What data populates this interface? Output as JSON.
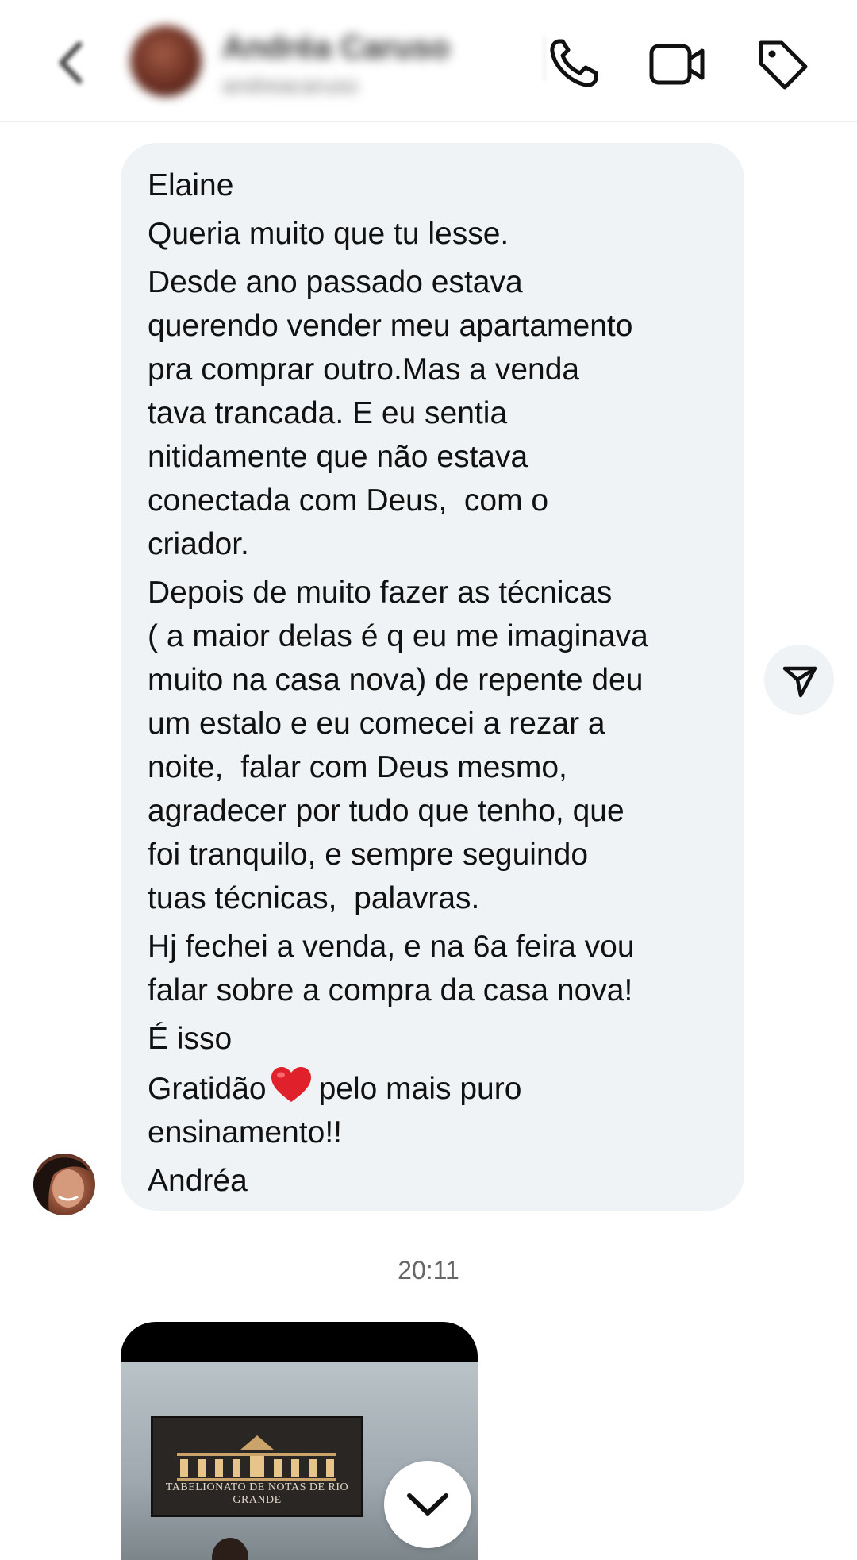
{
  "header": {
    "contact_name": "Andréa Caruso",
    "contact_username": "andreacaruso",
    "icons": [
      "back-arrow-icon",
      "phone-icon",
      "video-camera-icon",
      "tag-icon"
    ]
  },
  "message": {
    "lines": [
      "Elaine",
      "Queria muito que tu lesse.",
      "Desde ano passado estava",
      "querendo vender meu apartamento",
      "pra comprar outro.Mas a venda",
      "tava trancada. E eu sentia",
      "nitidamente que não estava",
      "conectada com Deus,  com o",
      "criador.",
      "Depois de muito fazer as técnicas",
      "( a maior delas é q eu me imaginava",
      "muito na casa nova) de repente deu",
      "um estalo e eu comecei a rezar a",
      "noite,  falar com Deus mesmo,",
      "agradecer por tudo que tenho, que",
      "foi tranquilo, e sempre seguindo",
      "tuas técnicas,  palavras.",
      "Hj fechei a venda, e na 6a feira vou",
      "falar sobre a compra da casa nova!",
      "É isso",
      "Gratidão",
      "pelo mais puro",
      "ensinamento!!",
      "Andréa"
    ]
  },
  "timestamp": "20:11",
  "media": {
    "sign_text": "TABELIONATO DE NOTAS DE RIO GRANDE"
  },
  "colors": {
    "bubble": "#eff3f5",
    "heart": "#e0202a",
    "text": "#111111"
  }
}
